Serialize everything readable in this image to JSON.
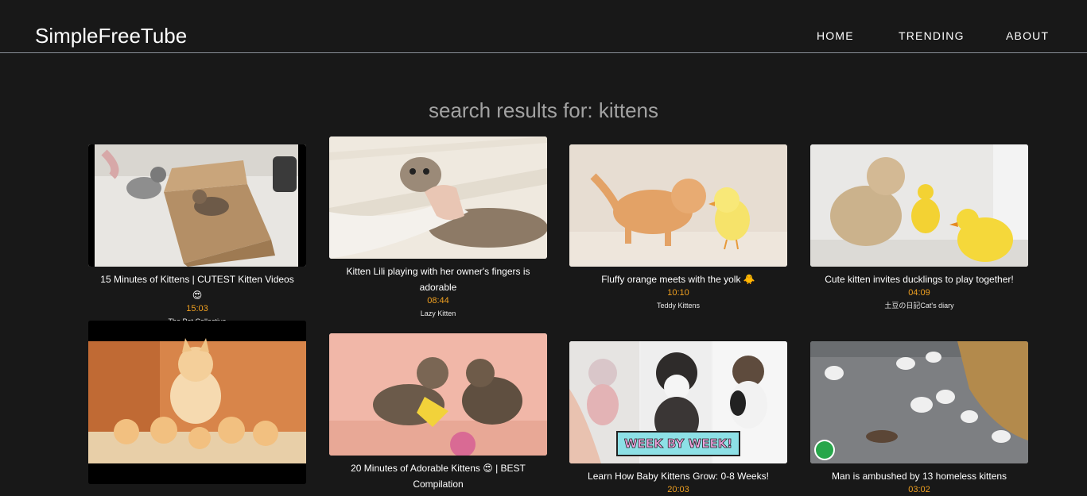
{
  "app": {
    "title": "SimpleFreeTube"
  },
  "nav": {
    "home": "HOME",
    "trending": "TRENDING",
    "about": "ABOUT"
  },
  "search": {
    "heading": "search results for: kittens"
  },
  "videos": [
    {
      "title": "15 Minutes of Kittens | CUTEST Kitten Videos 😍",
      "duration": "15:03",
      "channel": "The Pet Collective"
    },
    {
      "title": "Kitten Lili playing with her owner's fingers is adorable",
      "duration": "08:44",
      "channel": "Lazy Kitten"
    },
    {
      "title": "Fluffy orange meets with the yolk 🐥",
      "duration": "10:10",
      "channel": "Teddy Kittens"
    },
    {
      "title": "Cute kitten invites ducklings to play together!",
      "duration": "04:09",
      "channel": "土豆の日記Cat's diary"
    },
    {
      "title": "",
      "duration": "",
      "channel": ""
    },
    {
      "title": "20 Minutes of Adorable Kittens 😍 | BEST Compilation",
      "duration": "",
      "channel": ""
    },
    {
      "title": "Learn How Baby Kittens Grow: 0-8 Weeks!",
      "duration": "20:03",
      "channel": ""
    },
    {
      "title": "Man is ambushed by 13 homeless kittens",
      "duration": "03:02",
      "channel": ""
    }
  ],
  "thumb_overlay": {
    "week_by_week": "WEEK BY WEEK!"
  },
  "colors": {
    "background": "#181818",
    "accent": "#f0a020",
    "muted_heading": "#a2a2a2",
    "divider": "#8a8f99"
  }
}
